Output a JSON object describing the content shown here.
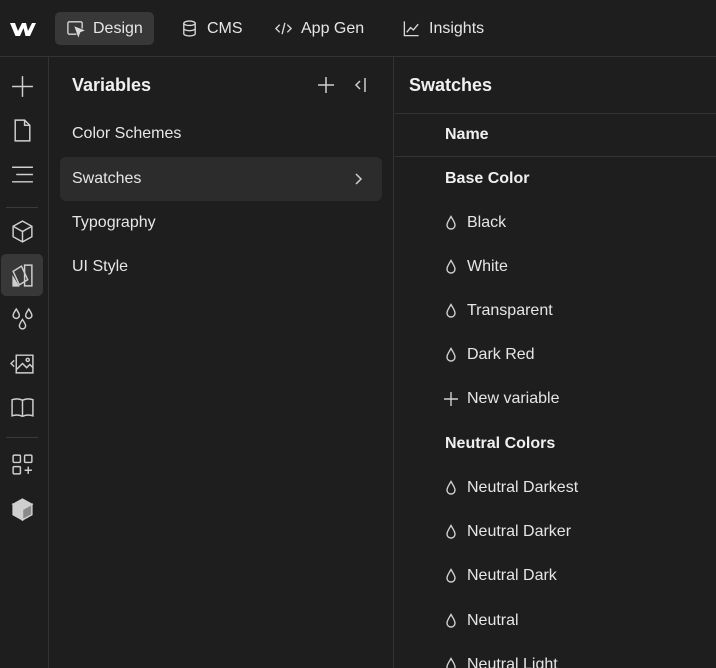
{
  "topbar": {
    "tabs": [
      {
        "label": "Design",
        "icon": "cursor-box-icon"
      },
      {
        "label": "CMS",
        "icon": "database-icon"
      },
      {
        "label": "App Gen",
        "icon": "code-icon"
      },
      {
        "label": "Insights",
        "icon": "chart-line-icon"
      }
    ],
    "active_tab": "Design"
  },
  "rail": {
    "icons": [
      "add-icon",
      "page-icon",
      "navigator-icon",
      "components-icon",
      "style-panel-icon",
      "variables-icon",
      "assets-icon",
      "library-icon",
      "apps-icon",
      "package-icon"
    ],
    "active": "style-panel-icon"
  },
  "variables_panel": {
    "title": "Variables",
    "items": [
      {
        "label": "Color Schemes"
      },
      {
        "label": "Swatches"
      },
      {
        "label": "Typography"
      },
      {
        "label": "UI Style"
      }
    ],
    "active_item": "Swatches"
  },
  "swatches_panel": {
    "title": "Swatches",
    "column_header": "Name",
    "rows": [
      {
        "type": "group",
        "label": "Base Color"
      },
      {
        "type": "var",
        "label": "Black",
        "icon": "drop-icon"
      },
      {
        "type": "var",
        "label": "White",
        "icon": "drop-icon"
      },
      {
        "type": "var",
        "label": "Transparent",
        "icon": "drop-icon"
      },
      {
        "type": "var",
        "label": "Dark Red",
        "icon": "drop-icon"
      },
      {
        "type": "var",
        "label": "New variable",
        "icon": "plus-icon"
      },
      {
        "type": "group",
        "label": "Neutral Colors"
      },
      {
        "type": "var",
        "label": "Neutral Darkest",
        "icon": "drop-icon"
      },
      {
        "type": "var",
        "label": "Neutral Darker",
        "icon": "drop-icon"
      },
      {
        "type": "var",
        "label": "Neutral Dark",
        "icon": "drop-icon"
      },
      {
        "type": "var",
        "label": "Neutral",
        "icon": "drop-icon"
      },
      {
        "type": "var",
        "label": "Neutral Light",
        "icon": "drop-icon"
      }
    ]
  },
  "colors": {
    "background": "#1e1e1e",
    "active_bg": "#383838",
    "selected_row_bg": "#2c2c2c",
    "border": "#333333",
    "text": "#e6e6e6"
  }
}
